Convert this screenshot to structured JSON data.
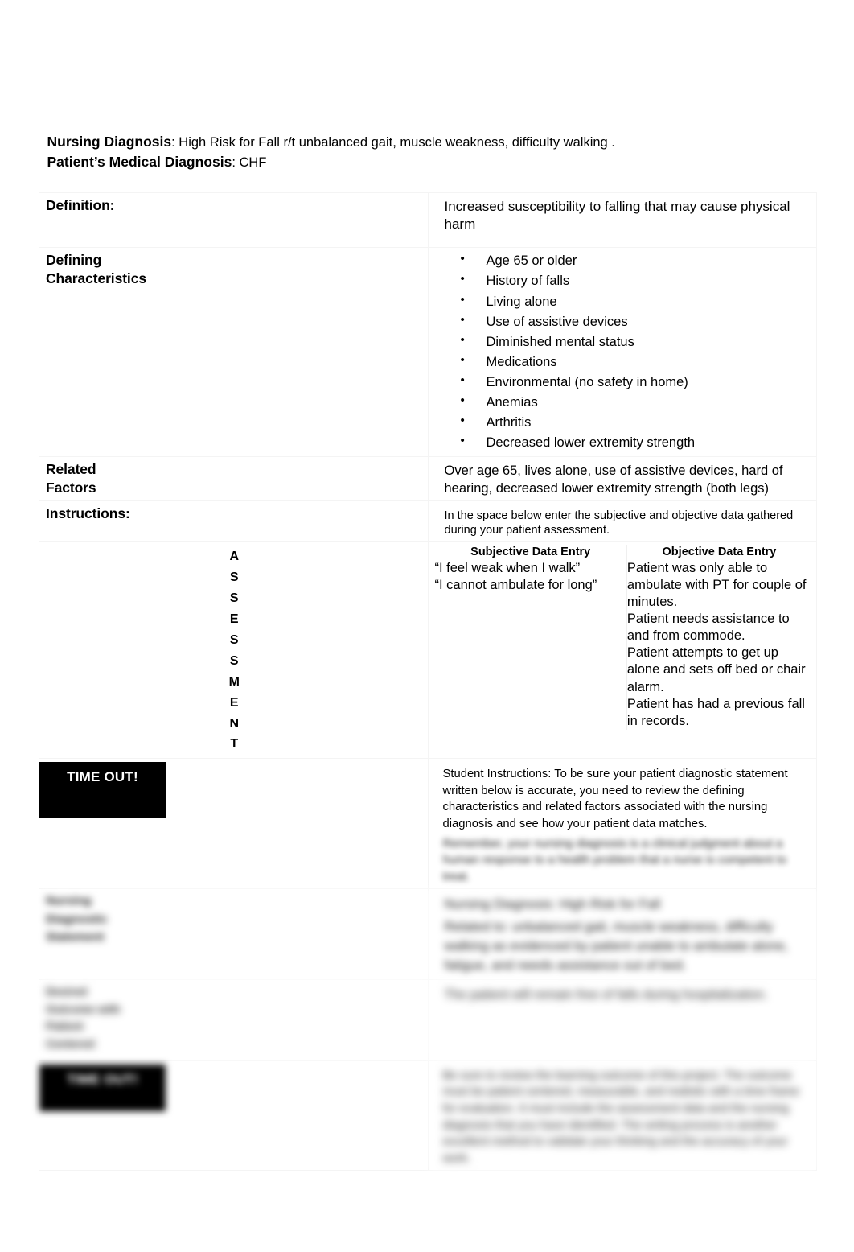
{
  "document": {
    "type": "nursing-care-plan-worksheet"
  },
  "header": {
    "nursing_diagnosis_label": "Nursing Diagnosis",
    "nursing_diagnosis_value": ": High Risk for Fall r/t unbalanced gait, muscle weakness, difficulty walking .",
    "medical_diagnosis_label": "Patient’s Medical Diagnosis",
    "medical_diagnosis_value": ": CHF"
  },
  "rows": {
    "definition": {
      "label": "Definition:",
      "text": "Increased susceptibility to falling that may cause physical harm"
    },
    "defining_characteristics": {
      "label_line1": "Defining",
      "label_line2": "Characteristics",
      "items": [
        "Age 65 or older",
        "History of falls",
        "Living alone",
        "Use of assistive devices",
        "Diminished mental status",
        "Medications",
        "Environmental (no safety in home)",
        "Anemias",
        "Arthritis",
        "Decreased lower extremity strength"
      ]
    },
    "related_factors": {
      "label_line1": "Related",
      "label_line2": "Factors",
      "text": "Over age 65, lives alone, use of assistive devices, hard of hearing, decreased lower extremity strength (both legs)"
    },
    "instructions": {
      "label": "Instructions:",
      "text": "In the space below enter the subjective and objective data gathered during your patient assessment."
    },
    "assessment": {
      "vertical_label": "ASSESSMENT",
      "letters": [
        "A",
        "S",
        "S",
        "E",
        "S",
        "S",
        "M",
        "E",
        "N",
        "T"
      ],
      "subjective_header": "Subjective Data Entry",
      "objective_header": "Objective Data Entry",
      "subjective_lines": [
        "“I feel weak when I walk”",
        "“I cannot ambulate for long”"
      ],
      "objective_lines": [
        "Patient was only able to ambulate with PT for couple of minutes.",
        "Patient needs assistance to and from commode.",
        "Patient attempts to get up alone and sets off bed or chair alarm.",
        "Patient has had a previous fall in records."
      ]
    },
    "time_out": {
      "badge": "TIME OUT!",
      "student_instructions": "Student Instructions: To be sure your patient diagnostic statement written below is accurate, you need to review the defining characteristics and related factors associated with the nursing diagnosis and see how your patient data matches.",
      "student_instructions_line3": "Remember, your nursing diagnosis is a clinical judgment about a human response to a health problem that a nurse is competent to treat."
    },
    "diagnostic_statement": {
      "label_line1": "Nursing",
      "label_line2": "Diagnostic",
      "label_line3": "Statement",
      "title": "Nursing Diagnosis: High Risk for Fall",
      "body": "Related to: unbalanced gait, muscle weakness, difficulty walking as evidenced by patient unable to ambulate alone, fatigue, and needs assistance out of bed."
    },
    "goal": {
      "label_line1": "Desired",
      "label_line2": "Outcome with",
      "label_line3": "Patient",
      "label_line4": "Centered",
      "text": "The patient will remain free of falls during hospitalization."
    },
    "final_note": {
      "badge": "TIME OUT!",
      "text": "Be sure to review the learning outcome of this project. The outcome must be patient centered, measurable, and realistic with a time frame for evaluation. It must include the assessment data and the nursing diagnosis that you have identified. The writing process is another excellent method to validate your thinking and the accuracy of your work."
    }
  }
}
